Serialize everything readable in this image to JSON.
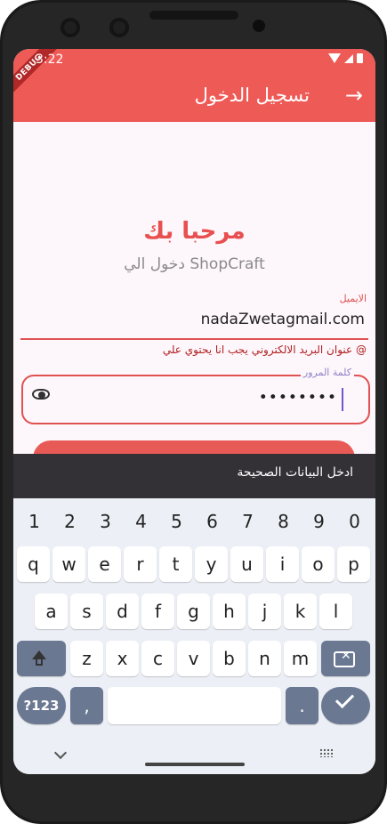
{
  "status": {
    "time": "3:22"
  },
  "debug_banner": "DEBUG",
  "appbar": {
    "title": "تسجيل الدخول",
    "back_icon": "→"
  },
  "welcome": {
    "title": "مرحبا بك",
    "subtitle": "دخول الي ShopCraft"
  },
  "email": {
    "label": "الايميل",
    "value": "nadaZwetagmail.com",
    "error": "عنوان البريد الالكتروني يجب انا يحتوي علي @"
  },
  "password": {
    "label": "كلمة المرور",
    "value": "••••••••"
  },
  "snackbar": {
    "message": "ادخل البيانات الصحيحة"
  },
  "keyboard": {
    "row_numbers": [
      "1",
      "2",
      "3",
      "4",
      "5",
      "6",
      "7",
      "8",
      "9",
      "0"
    ],
    "row1": [
      "q",
      "w",
      "e",
      "r",
      "t",
      "y",
      "u",
      "i",
      "o",
      "p"
    ],
    "row2": [
      "a",
      "s",
      "d",
      "f",
      "g",
      "h",
      "j",
      "k",
      "l"
    ],
    "row3": [
      "z",
      "x",
      "c",
      "v",
      "b",
      "n",
      "m"
    ],
    "symbols_key": "?123",
    "comma_key": ",",
    "period_key": "."
  },
  "colors": {
    "appbar": "#ee5a56",
    "error": "#e05252",
    "snackbar": "#333036"
  }
}
